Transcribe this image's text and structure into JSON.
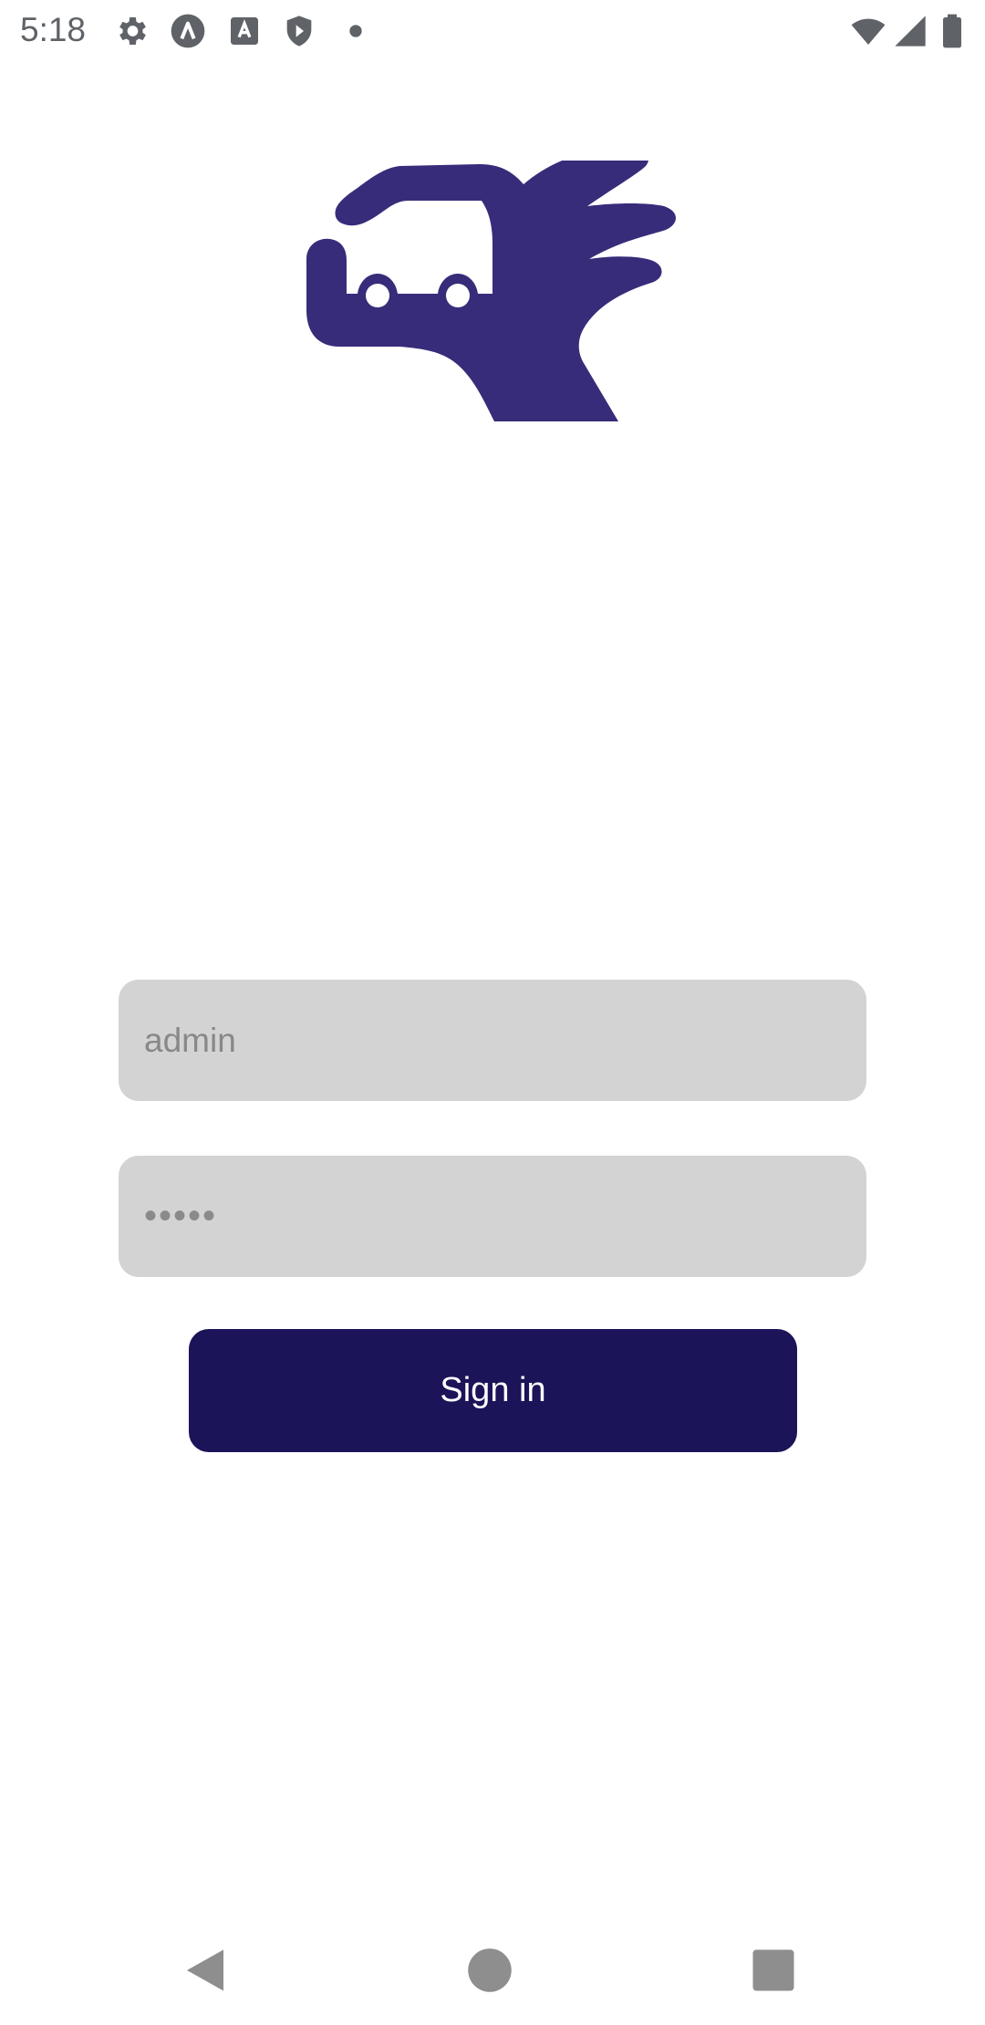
{
  "status_bar": {
    "time": "5:18",
    "left_icons": [
      "gear-icon",
      "a-circle-icon",
      "a-box-icon",
      "shield-play-icon",
      "dot-icon"
    ],
    "right_icons": [
      "wifi-icon",
      "signal-icon",
      "battery-icon"
    ]
  },
  "logo": {
    "icon": "hand-car-logo",
    "color": "#372c7a"
  },
  "login_form": {
    "username_value": "admin",
    "password_value": "•••••",
    "signin_label": "Sign in",
    "button_color": "#1c1458",
    "field_color": "#d3d3d3"
  },
  "nav_bar": {
    "items": [
      "back-icon",
      "home-icon",
      "recents-icon"
    ]
  }
}
